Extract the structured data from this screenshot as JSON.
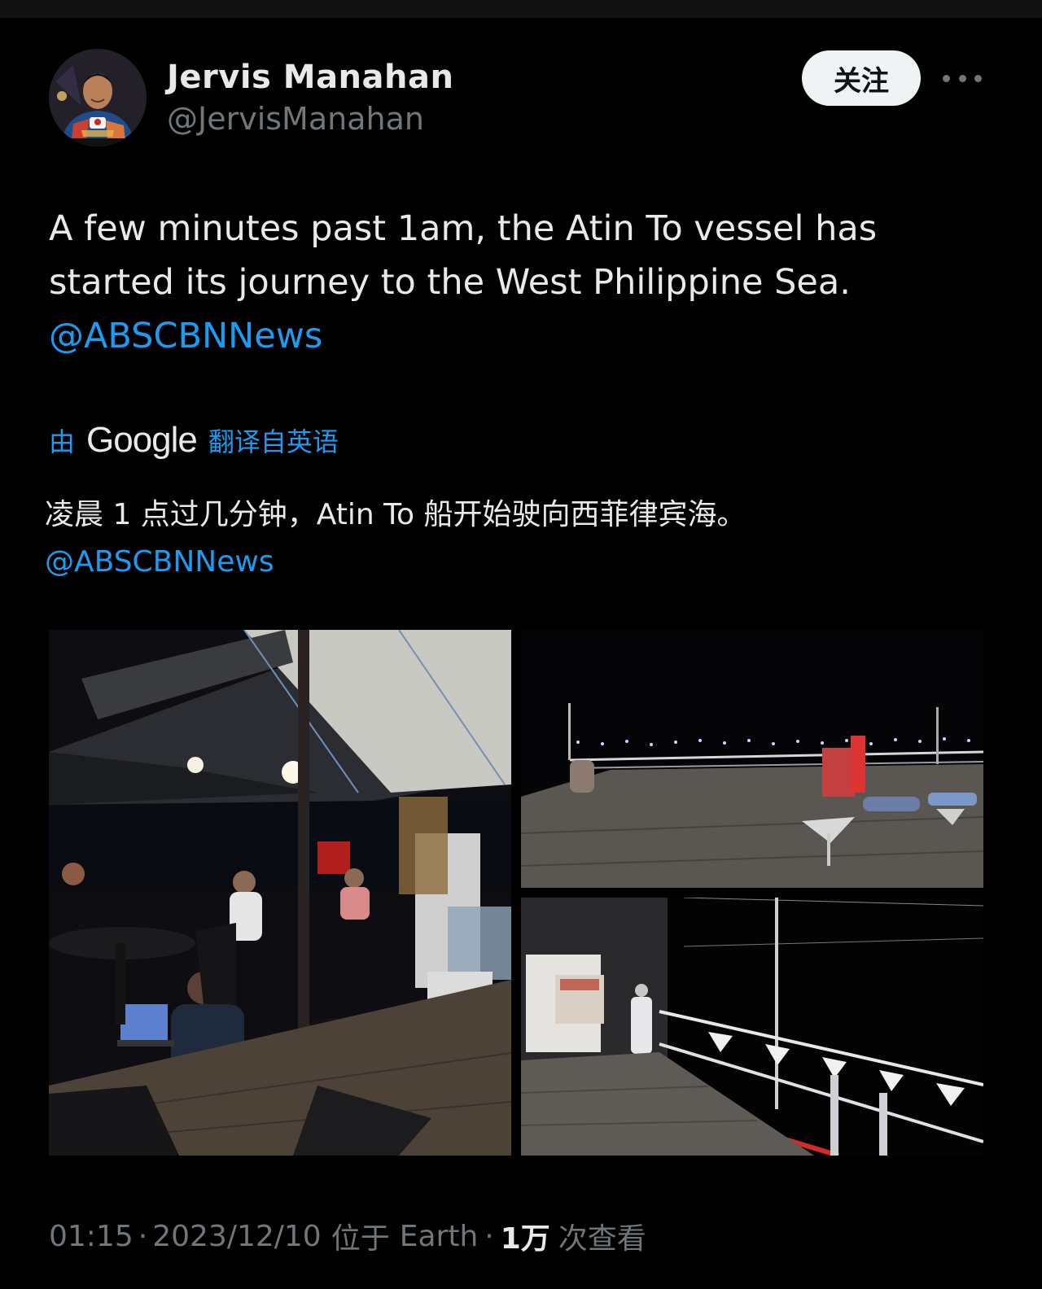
{
  "author": {
    "name": "Jervis Manahan",
    "handle": "@JervisManahan",
    "avatar_icon": "profile-photo"
  },
  "actions": {
    "follow_label": "关注",
    "more_icon": "more-horizontal-icon"
  },
  "tweet": {
    "text": "A few minutes past 1am, the Atin To vessel has started its journey to the West Philippine Sea.",
    "mention": "@ABSCBNNews"
  },
  "translation": {
    "prefix": "由",
    "provider": "Google",
    "label": "翻译自英语",
    "text": "凌晨 1 点过几分钟，Atin To 船开始驶向西菲律宾海。",
    "mention": "@ABSCBNNews"
  },
  "media": {
    "count": 3
  },
  "meta": {
    "time": "01:15",
    "date": "2023/12/10",
    "location_prefix": "位于",
    "location": "Earth",
    "separator": "·",
    "views": "1万",
    "views_label": "次查看"
  },
  "colors": {
    "background": "#000000",
    "text": "#e7e9ea",
    "secondary": "#71767b",
    "link": "#1d9bf0",
    "follow_bg": "#eff3f4"
  }
}
